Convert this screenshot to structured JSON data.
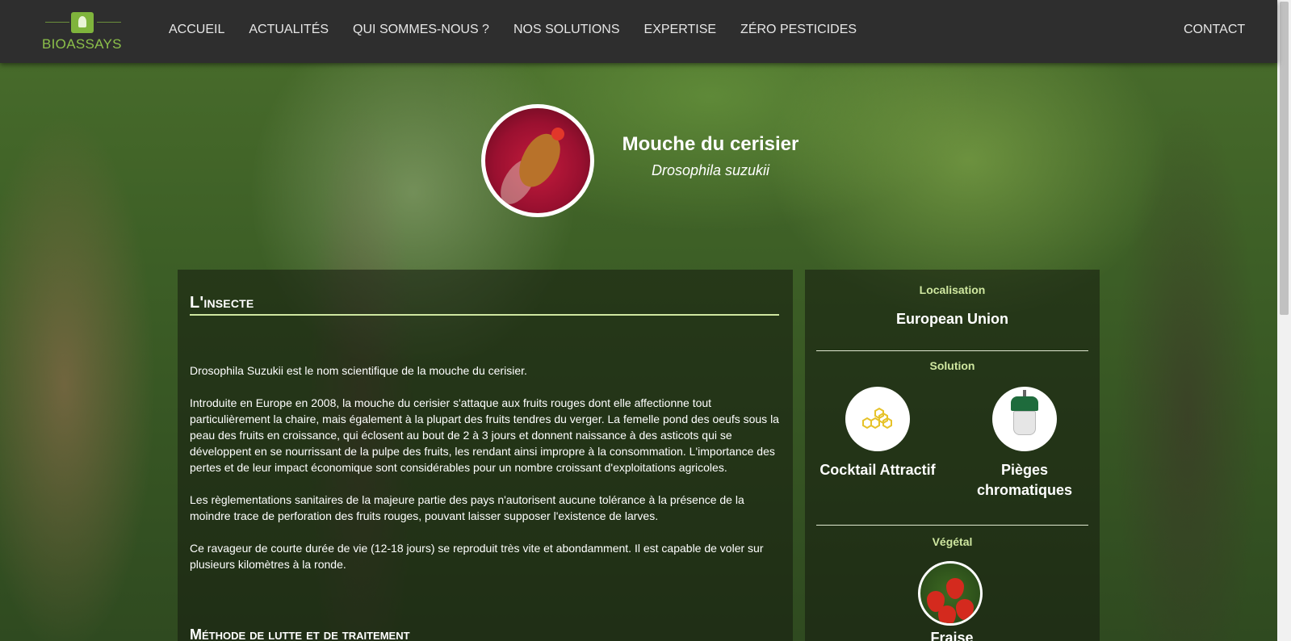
{
  "header": {
    "logo_text_1": "BIO",
    "logo_text_2": "ASSAYS",
    "nav": [
      "ACCUEIL",
      "ACTUALITÉS",
      "QUI SOMMES-NOUS ?",
      "NOS SOLUTIONS",
      "EXPERTISE",
      "ZÉRO PESTICIDES"
    ],
    "contact": "CONTACT"
  },
  "hero": {
    "title": "Mouche du cerisier",
    "subtitle": "Drosophila suzukii"
  },
  "main": {
    "section_title": "L'insecte",
    "paragraphs": [
      "Drosophila Suzukii est le nom scientifique de la mouche du cerisier.",
      "Introduite en Europe en 2008, la mouche du cerisier s'attaque aux fruits rouges dont elle affectionne tout particulièrement la chaire, mais également à la plupart des fruits tendres du verger. La femelle pond des oeufs sous la peau des fruits en croissance, qui éclosent au bout de 2 à 3 jours et donnent naissance à des asticots qui se développent en se nourrissant de la pulpe des fruits, les rendant ainsi impropre à la consommation. L'importance des pertes et de leur impact économique sont considérables pour un nombre croissant d'exploitations agricoles.",
      "Les règlementations sanitaires de la majeure partie des pays n'autorisent aucune tolérance à la présence de la moindre trace de perforation des fruits rouges, pouvant laisser supposer l'existence de larves.",
      "Ce ravageur de courte durée de vie (12-18 jours) se reproduit très vite et abondamment. Il est capable de voler sur plusieurs kilomètres à la ronde."
    ],
    "section_title_2": "Méthode de lutte et de traitement"
  },
  "side": {
    "localisation_label": "Localisation",
    "localisation_value": "European Union",
    "solution_label": "Solution",
    "solutions": [
      {
        "label": "Cocktail Attractif",
        "icon": "honeycomb-icon"
      },
      {
        "label": "Pièges chromatiques",
        "icon": "trap-icon"
      }
    ],
    "vegetal_label": "Végétal",
    "vegetal_value": "Fraise"
  },
  "colors": {
    "header_bg": "#2e2e2e",
    "accent_green": "#8cc04a",
    "label_green": "#cfe7a0",
    "honeycomb": "#e6c229"
  }
}
